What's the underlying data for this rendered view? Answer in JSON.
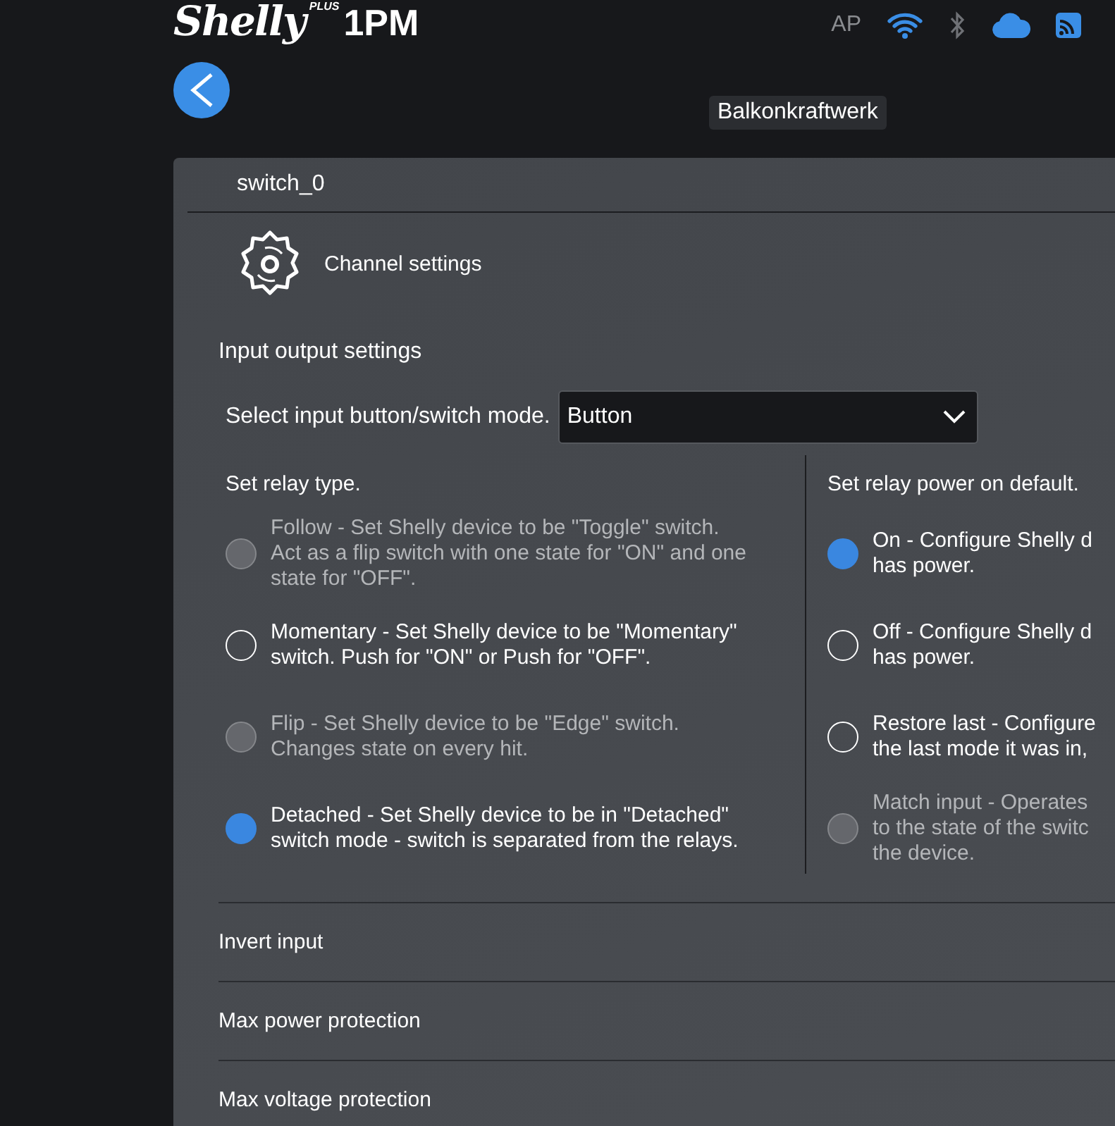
{
  "header": {
    "logo": {
      "brand": "Shelly",
      "plus": "PLUS",
      "model": "1PM"
    },
    "status": [
      {
        "kind": "text",
        "label": "AP",
        "on": false
      },
      {
        "kind": "wifi",
        "on": true
      },
      {
        "kind": "bluetooth",
        "on": false
      },
      {
        "kind": "cloud",
        "on": true
      },
      {
        "kind": "signal",
        "on": true
      }
    ]
  },
  "device_name": "Balkonkraftwerk",
  "card": {
    "title": "switch_0",
    "section_title": "Channel settings",
    "group_title": "Input output settings",
    "mode_select": {
      "label": "Select input button/switch mode.",
      "value": "Button"
    },
    "relay_type": {
      "title": "Set relay type.",
      "options": [
        {
          "lines": [
            "Follow - Set Shelly device to be \"Toggle\" switch.",
            "Act as a flip switch with one state for \"ON\" and one",
            "state for \"OFF\"."
          ],
          "selected": false,
          "disabled": true
        },
        {
          "lines": [
            "Momentary - Set Shelly device to be \"Momentary\"",
            "switch. Push for \"ON\" or Push for \"OFF\"."
          ],
          "selected": false,
          "disabled": false
        },
        {
          "lines": [
            "Flip - Set Shelly device to be \"Edge\" switch.",
            "Changes state on every hit."
          ],
          "selected": false,
          "disabled": true
        },
        {
          "lines": [
            "Detached - Set Shelly device to be in \"Detached\"",
            "switch mode - switch is separated from the relays."
          ],
          "selected": true,
          "disabled": false
        }
      ]
    },
    "power_on_default": {
      "title": "Set relay power on default.",
      "options": [
        {
          "lines": [
            "On - Configure Shelly d",
            "has power."
          ],
          "selected": true,
          "disabled": false
        },
        {
          "lines": [
            "Off - Configure Shelly d",
            "has power."
          ],
          "selected": false,
          "disabled": false
        },
        {
          "lines": [
            "Restore last - Configure",
            "the last mode it was in,"
          ],
          "selected": false,
          "disabled": false
        },
        {
          "lines": [
            "Match input - Operates",
            "to the state of the switc",
            "the device."
          ],
          "selected": false,
          "disabled": true
        }
      ]
    },
    "collapsed_sections": [
      {
        "label": "Invert input"
      },
      {
        "label": "Max power protection"
      },
      {
        "label": "Max voltage protection"
      }
    ]
  }
}
